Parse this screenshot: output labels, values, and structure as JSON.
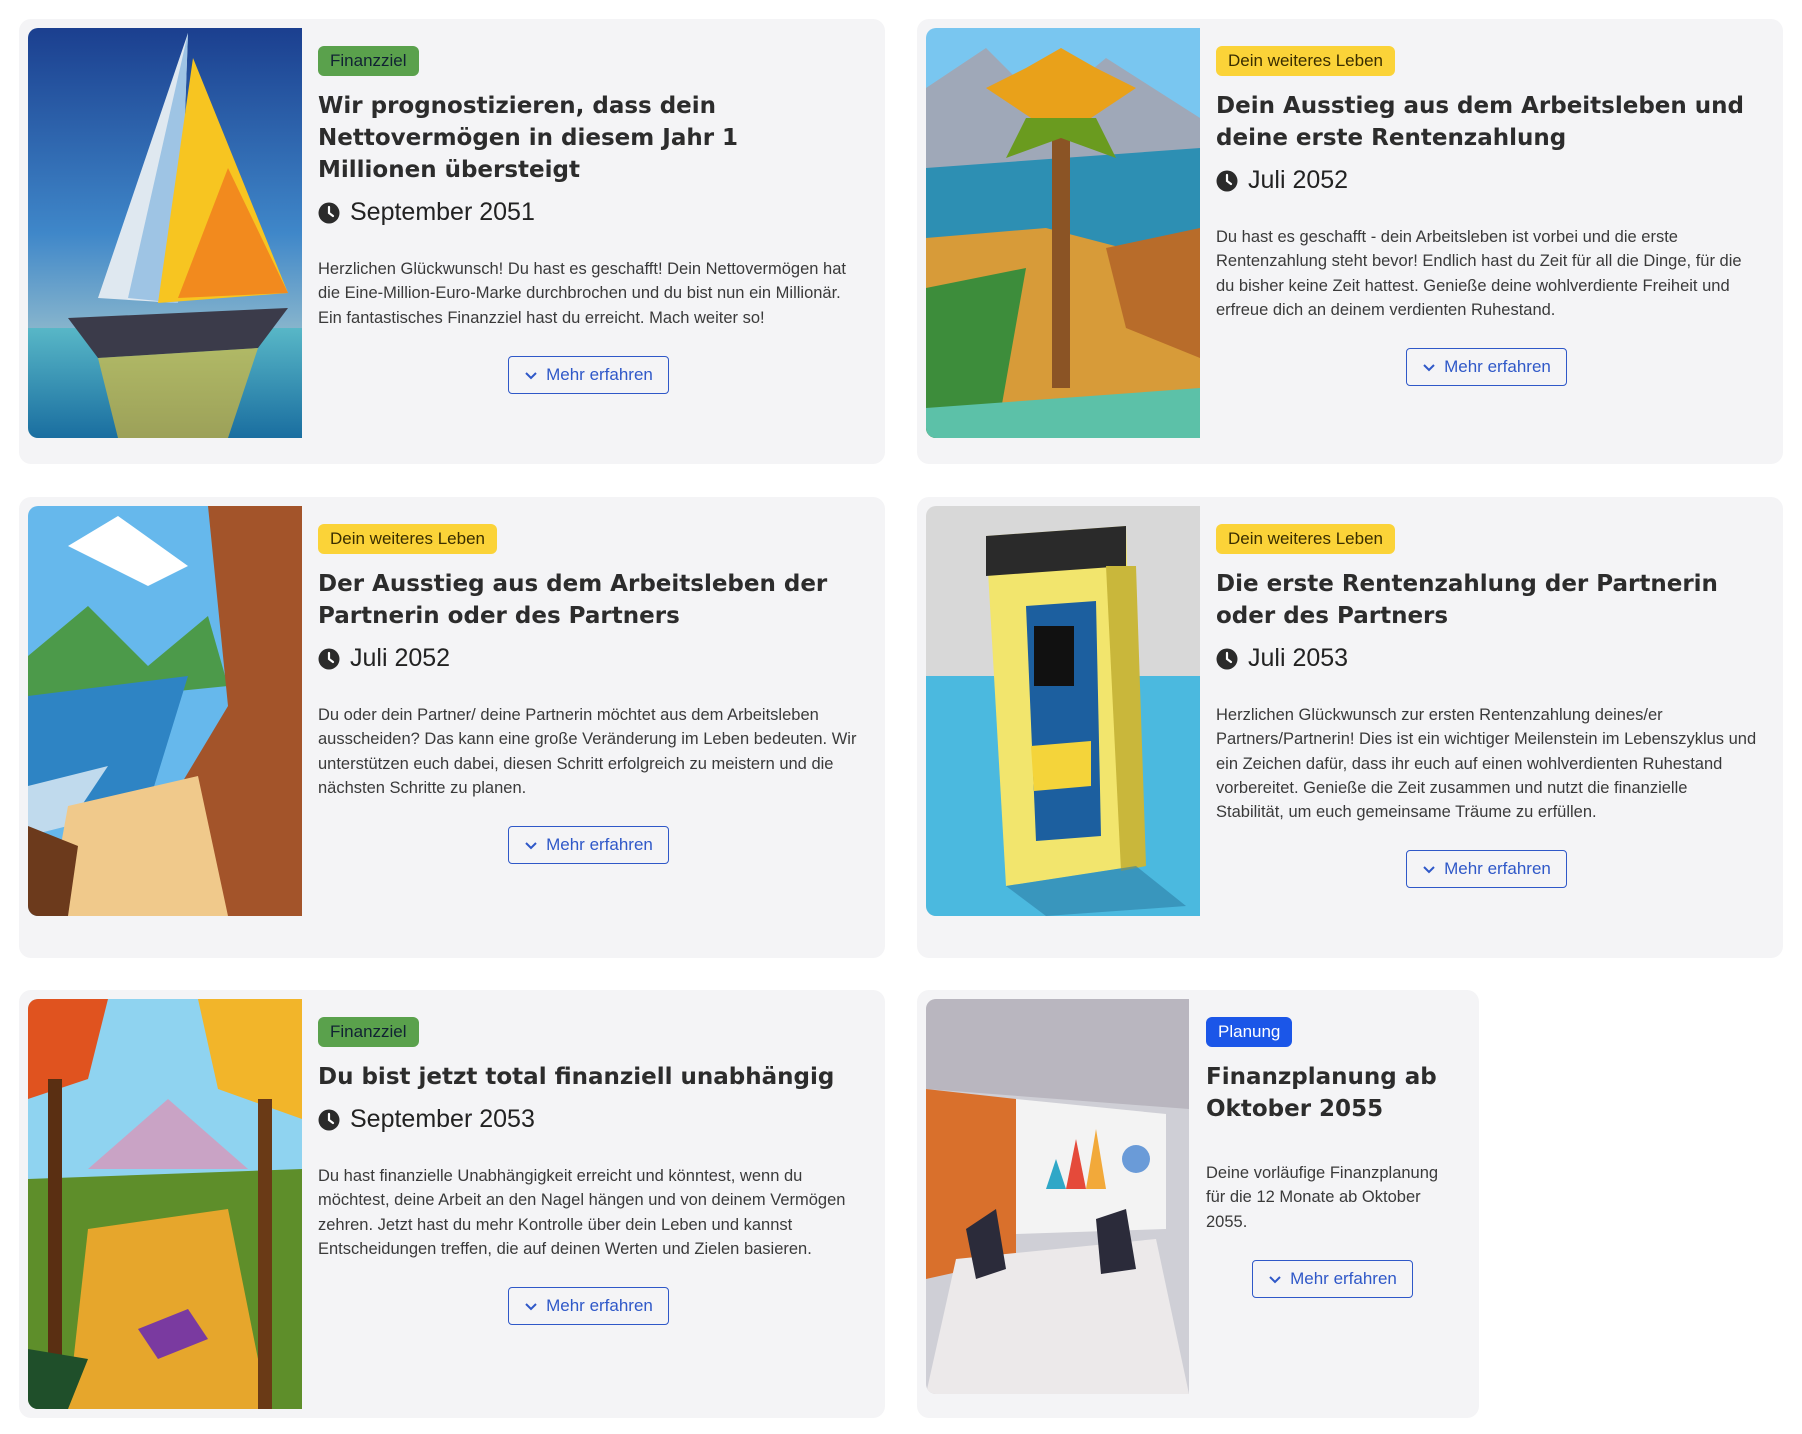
{
  "button_label": "Mehr erfahren",
  "cards": [
    {
      "badge": "Finanzziel",
      "title": "Wir prognostizieren, dass dein Nettovermögen in diesem Jahr 1 Millionen übersteigt",
      "date": "September 2051",
      "description": "Herzlichen Glückwunsch! Du hast es geschafft! Dein Nettovermögen hat die Eine-Million-Euro-Marke durchbrochen und du bist nun ein Millionär. Ein fantastisches Finanzziel hast du erreicht. Mach weiter so!"
    },
    {
      "badge": "Dein weiteres Leben",
      "title": "Dein Ausstieg aus dem Arbeitsleben und deine erste Rentenzahlung",
      "date": "Juli 2052",
      "description": "Du hast es geschafft - dein Arbeitsleben ist vorbei und die erste Rentenzahlung steht bevor! Endlich hast du Zeit für all die Dinge, für die du bisher keine Zeit hattest. Genieße deine wohlverdiente Freiheit und erfreue dich an deinem verdienten Ruhestand."
    },
    {
      "badge": "Dein weiteres Leben",
      "title": "Der Ausstieg aus dem Arbeitsleben der Partnerin oder des Partners",
      "date": "Juli 2052",
      "description": "Du oder dein Partner/ deine Partnerin möchtet aus dem Arbeitsleben ausscheiden? Das kann eine große Veränderung im Leben bedeuten. Wir unterstützen euch dabei, diesen Schritt erfolgreich zu meistern und die nächsten Schritte zu planen."
    },
    {
      "badge": "Dein weiteres Leben",
      "title": "Die erste Rentenzahlung der Partnerin oder des Partners",
      "date": "Juli 2053",
      "description": "Herzlichen Glückwunsch zur ersten Rentenzahlung deines/er Partners/Partnerin! Dies ist ein wichtiger Meilenstein im Lebenszyklus und ein Zeichen dafür, dass ihr euch auf einen wohlverdienten Ruhestand vorbereitet. Genieße die Zeit zusammen und nutzt die finanzielle Stabilität, um euch gemeinsame Träume zu erfüllen."
    },
    {
      "badge": "Finanzziel",
      "title": "Du bist jetzt total finanziell unabhängig",
      "date": "September 2053",
      "description": "Du hast finanzielle Unabhängigkeit erreicht und könntest, wenn du möchtest, deine Arbeit an den Nagel hängen und von deinem Vermögen zehren. Jetzt hast du mehr Kontrolle über dein Leben und kannst Entscheidungen treffen, die auf deinen Werten und Zielen basieren."
    },
    {
      "badge": "Planung",
      "title": "Finanzplanung ab Oktober 2055",
      "date": "",
      "description": "Deine vorläufige Finanzplanung für die 12 Monate ab Oktober 2055."
    }
  ],
  "colors": {
    "badge_finanzziel": "#5aa14c",
    "badge_leben": "#fbd338",
    "badge_planung": "#1b56e8",
    "button_accent": "#2f58c8",
    "card_bg": "#f4f4f6"
  },
  "icons": [
    "clock-icon",
    "chevron-down-icon"
  ],
  "images": [
    "sailboat-image",
    "palm-tree-beach-image",
    "coastal-cliffs-image",
    "yellow-atm-kiosk-image",
    "autumn-forest-horse-image",
    "office-meeting-image"
  ]
}
